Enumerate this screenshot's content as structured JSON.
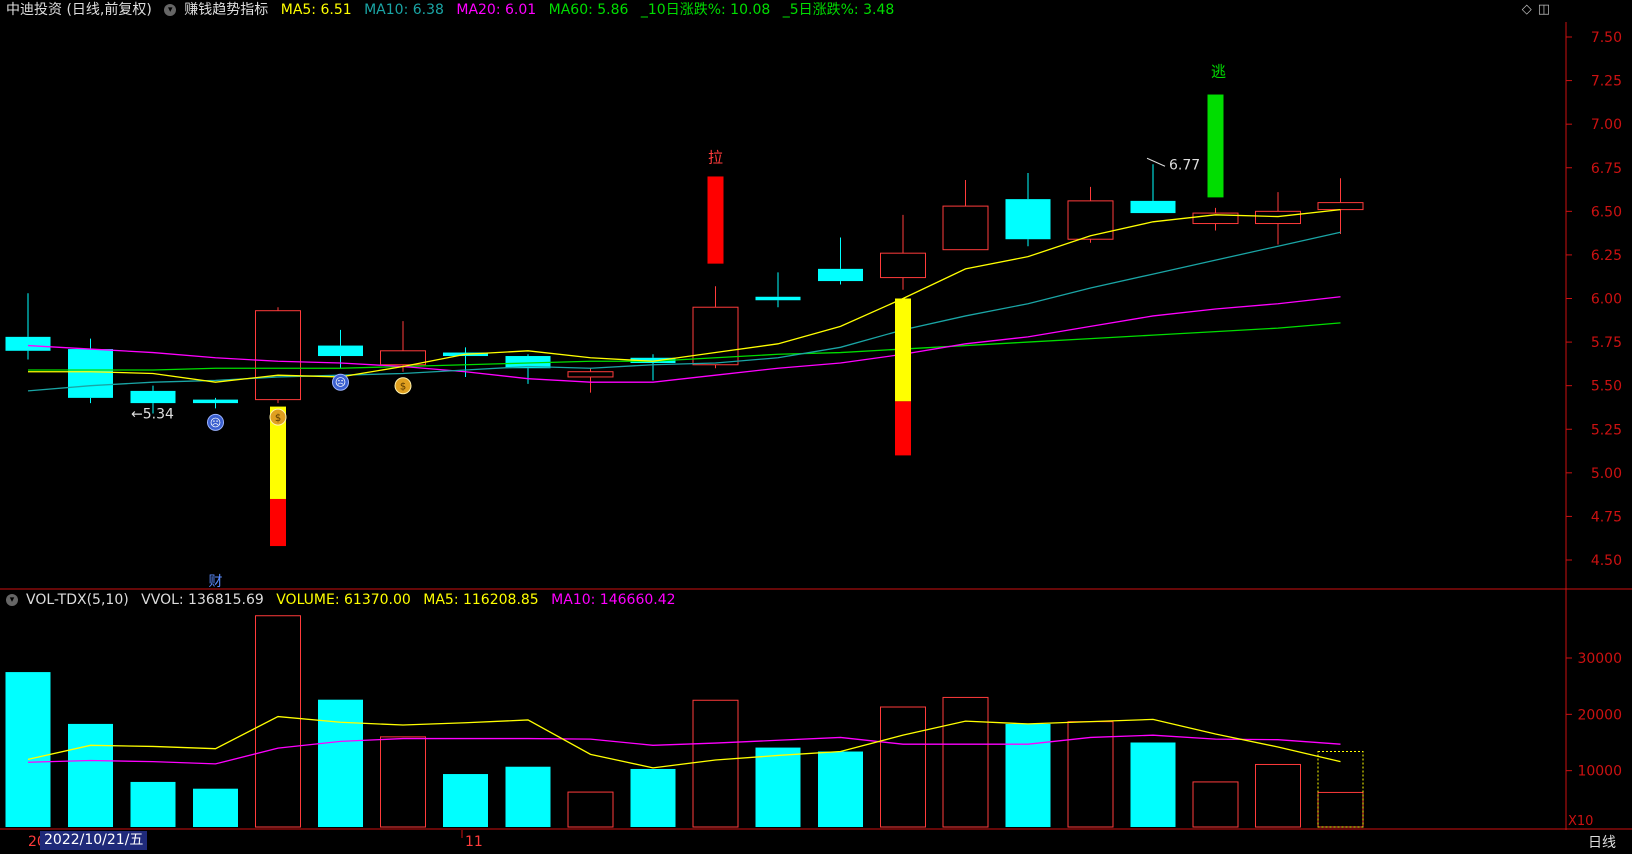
{
  "header": {
    "stock_name": "中迪投资 (日线,前复权)",
    "indicator_name": "赚钱趋势指标",
    "ma5": "MA5: 6.51",
    "ma10": "MA10: 6.38",
    "ma20": "MA20: 6.01",
    "ma60": "MA60: 5.86",
    "chg10": "_10日涨跌%: 10.08",
    "chg5": "_5日涨跌%: 3.48"
  },
  "vol_header": {
    "name": "VOL-TDX(5,10)",
    "vvol": "VVOL: 136815.69",
    "volume": "VOLUME: 61370.00",
    "ma5": "MA5: 116208.85",
    "ma10": "MA10: 146660.42"
  },
  "window_icons": [
    "diamond-icon",
    "restore-icon"
  ],
  "bottom": {
    "date_prefix": "20",
    "date": "2022/10/21/五",
    "month_tick": "11",
    "period": "日线",
    "vol_scale": "X10"
  },
  "markers": {
    "cai": "财",
    "la": "拉",
    "tao": "逃",
    "low_label": "←5.34",
    "high_label": "6.77"
  },
  "colors": {
    "up": "#ff3b3b",
    "down": "#00ffff",
    "ma5": "#ffff00",
    "ma10": "#1aa5a5",
    "ma20": "#ff00ff",
    "ma60": "#00dd00",
    "axis": "#cc1111",
    "signal_yellow": "#ffff00",
    "signal_red": "#ff0000",
    "signal_green": "#00dd00"
  },
  "chart_data": {
    "type": "candlestick",
    "price_axis": {
      "ylim": [
        4.5,
        7.5
      ],
      "ticks": [
        "7.50",
        "7.25",
        "7.00",
        "6.75",
        "6.50",
        "6.25",
        "6.00",
        "5.75",
        "5.50",
        "5.25",
        "5.00",
        "4.75",
        "4.50"
      ]
    },
    "volume_axis": {
      "ticks": [
        "30000",
        "20000",
        "10000"
      ],
      "unit": "X10"
    },
    "candles": [
      {
        "o": 5.78,
        "c": 5.7,
        "h": 6.03,
        "l": 5.65,
        "v": 27500
      },
      {
        "o": 5.71,
        "c": 5.43,
        "h": 5.77,
        "l": 5.4,
        "v": 18300
      },
      {
        "o": 5.47,
        "c": 5.4,
        "h": 5.5,
        "l": 5.34,
        "v": 8000
      },
      {
        "o": 5.42,
        "c": 5.4,
        "h": 5.43,
        "l": 5.37,
        "v": 6800
      },
      {
        "o": 5.42,
        "c": 5.93,
        "h": 5.95,
        "l": 5.4,
        "v": 37500
      },
      {
        "o": 5.73,
        "c": 5.67,
        "h": 5.82,
        "l": 5.6,
        "v": 22600
      },
      {
        "o": 5.62,
        "c": 5.7,
        "h": 5.87,
        "l": 5.58,
        "v": 16000
      },
      {
        "o": 5.69,
        "c": 5.67,
        "h": 5.72,
        "l": 5.55,
        "v": 9400
      },
      {
        "o": 5.67,
        "c": 5.6,
        "h": 5.68,
        "l": 5.51,
        "v": 10700
      },
      {
        "o": 5.55,
        "c": 5.58,
        "h": 5.6,
        "l": 5.46,
        "v": 6200
      },
      {
        "o": 5.66,
        "c": 5.63,
        "h": 5.68,
        "l": 5.53,
        "v": 10300
      },
      {
        "o": 5.62,
        "c": 5.95,
        "h": 6.07,
        "l": 5.6,
        "v": 22500
      },
      {
        "o": 6.01,
        "c": 5.99,
        "h": 6.15,
        "l": 5.95,
        "v": 14100
      },
      {
        "o": 6.17,
        "c": 6.1,
        "h": 6.35,
        "l": 6.08,
        "v": 13400
      },
      {
        "o": 6.12,
        "c": 6.26,
        "h": 6.48,
        "l": 6.05,
        "v": 21300
      },
      {
        "o": 6.28,
        "c": 6.53,
        "h": 6.68,
        "l": 6.28,
        "v": 23000
      },
      {
        "o": 6.57,
        "c": 6.34,
        "h": 6.72,
        "l": 6.3,
        "v": 18300
      },
      {
        "o": 6.34,
        "c": 6.56,
        "h": 6.64,
        "l": 6.32,
        "v": 18700
      },
      {
        "o": 6.56,
        "c": 6.49,
        "h": 6.77,
        "l": 6.49,
        "v": 15000
      },
      {
        "o": 6.43,
        "c": 6.49,
        "h": 6.52,
        "l": 6.39,
        "v": 8000
      },
      {
        "o": 6.43,
        "c": 6.5,
        "h": 6.61,
        "l": 6.31,
        "v": 11100
      },
      {
        "o": 6.51,
        "c": 6.55,
        "h": 6.69,
        "l": 6.37,
        "v": 6137
      }
    ],
    "ma5": [
      5.58,
      5.58,
      5.57,
      5.52,
      5.56,
      5.55,
      5.61,
      5.68,
      5.7,
      5.66,
      5.64,
      5.69,
      5.74,
      5.84,
      6.0,
      6.17,
      6.24,
      6.36,
      6.44,
      6.48,
      6.47,
      6.51
    ],
    "ma10": [
      5.47,
      5.5,
      5.52,
      5.53,
      5.55,
      5.56,
      5.57,
      5.59,
      5.61,
      5.6,
      5.62,
      5.63,
      5.66,
      5.72,
      5.82,
      5.9,
      5.97,
      6.06,
      6.14,
      6.22,
      6.3,
      6.38
    ],
    "ma20": [
      5.73,
      5.71,
      5.69,
      5.66,
      5.64,
      5.63,
      5.61,
      5.58,
      5.54,
      5.52,
      5.52,
      5.56,
      5.6,
      5.63,
      5.68,
      5.74,
      5.78,
      5.84,
      5.9,
      5.94,
      5.97,
      6.01
    ],
    "ma60": [
      5.59,
      5.59,
      5.59,
      5.6,
      5.6,
      5.6,
      5.61,
      5.62,
      5.63,
      5.64,
      5.64,
      5.66,
      5.68,
      5.69,
      5.71,
      5.73,
      5.75,
      5.77,
      5.79,
      5.81,
      5.83,
      5.86
    ],
    "vol_ma5": [
      12000,
      14500,
      14300,
      13900,
      19600,
      18600,
      18100,
      18500,
      19000,
      12900,
      10500,
      11900,
      12700,
      13400,
      16300,
      18800,
      18300,
      18700,
      19100,
      16500,
      14200,
      11600
    ],
    "vol_ma10": [
      11500,
      11800,
      11600,
      11200,
      14000,
      15200,
      15700,
      15700,
      15700,
      15600,
      14500,
      14900,
      15400,
      15900,
      14700,
      14700,
      14700,
      15900,
      16300,
      15600,
      15500,
      14700
    ],
    "signals": [
      {
        "index": 4,
        "parts": [
          {
            "from": 5.38,
            "to": 4.85,
            "color": "yellow"
          },
          {
            "from": 4.85,
            "to": 4.58,
            "color": "red"
          }
        ]
      },
      {
        "index": 11,
        "parts": [
          {
            "from": 6.7,
            "to": 6.2,
            "color": "red"
          }
        ]
      },
      {
        "index": 14,
        "parts": [
          {
            "from": 6.0,
            "to": 5.41,
            "color": "yellow"
          },
          {
            "from": 5.41,
            "to": 5.1,
            "color": "red"
          }
        ]
      },
      {
        "index": 19,
        "parts": [
          {
            "from": 7.17,
            "to": 6.58,
            "color": "green"
          }
        ]
      }
    ],
    "icons": [
      {
        "index": 3,
        "name": "sad-face-icon"
      },
      {
        "index": 4,
        "name": "money-bag-icon"
      },
      {
        "index": 5,
        "name": "sad-face-icon"
      },
      {
        "index": 6,
        "name": "money-bag-icon"
      }
    ]
  }
}
